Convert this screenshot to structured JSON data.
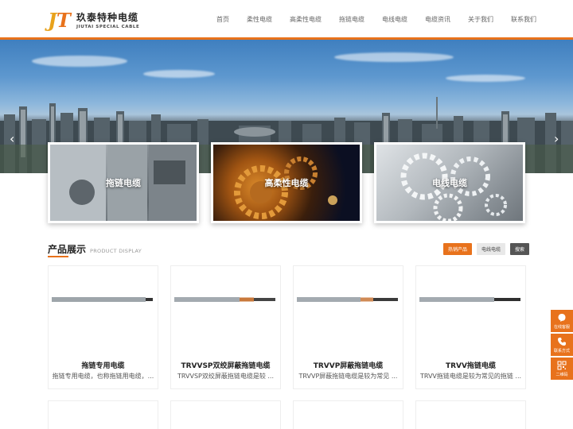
{
  "logo": {
    "cn": "玖泰特种电缆",
    "en": "JIUTAI SPECIAL CABLE",
    "mark_j": "J",
    "mark_t": "T"
  },
  "nav": [
    {
      "label": "首页"
    },
    {
      "label": "柔性电缆"
    },
    {
      "label": "高柔性电缆"
    },
    {
      "label": "拖链电缆"
    },
    {
      "label": "电线电缆"
    },
    {
      "label": "电缆资讯"
    },
    {
      "label": "关于我们"
    },
    {
      "label": "联系我们"
    }
  ],
  "banner": {
    "prev_arrow": "‹",
    "next_arrow": "›"
  },
  "categories": [
    {
      "label": "拖链电缆"
    },
    {
      "label": "高柔性电缆"
    },
    {
      "label": "电线电缆"
    }
  ],
  "section": {
    "title": "产品展示",
    "subtitle": "PRODUCT DISPLAY",
    "tabs": [
      {
        "label": "热销产品",
        "active": true
      },
      {
        "label": "电线电缆",
        "active": false
      },
      {
        "label": "搜索",
        "active": false
      }
    ]
  },
  "products": [
    {
      "name": "拖链专用电缆",
      "desc": "拖链专用电缆，也称拖链用电缆，..."
    },
    {
      "name": "TRVVSP双绞屏蔽拖链电缆",
      "desc": "TRVVSP双绞屏蔽拖链电缆是较 ..."
    },
    {
      "name": "TRVVP屏蔽拖链电缆",
      "desc": "TRVVP屏蔽拖链电缆是较为常见 ..."
    },
    {
      "name": "TRVV拖链电缆",
      "desc": "TRVV拖链电缆是较为常见的拖链 ..."
    }
  ],
  "float": [
    {
      "label": "在线客服",
      "icon": "chat-icon"
    },
    {
      "label": "联系方式",
      "icon": "phone-icon"
    },
    {
      "label": "二维码",
      "icon": "qrcode-icon"
    }
  ],
  "colors": {
    "accent": "#e8721c",
    "nav_text": "#666666"
  }
}
